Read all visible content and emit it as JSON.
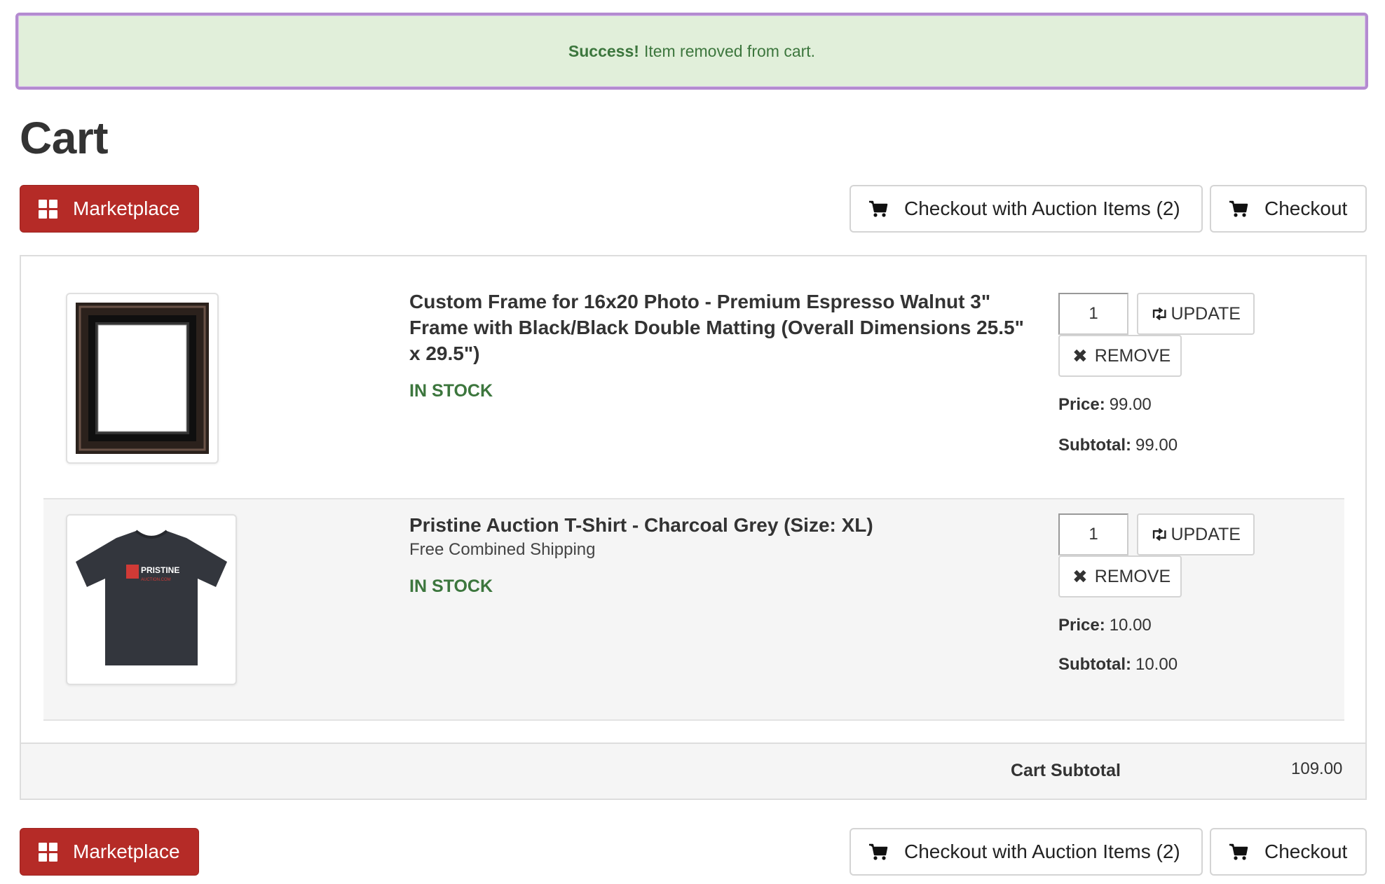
{
  "alert": {
    "strong": "Success!",
    "message": "Item removed from cart."
  },
  "page": {
    "title": "Cart"
  },
  "toolbar": {
    "marketplace_label": "Marketplace",
    "checkout_auction_label": "Checkout with Auction Items (2)",
    "checkout_label": "Checkout"
  },
  "items": [
    {
      "title": "Custom Frame for 16x20 Photo - Premium Espresso Walnut 3\" Frame with Black/Black Double Matting (Overall Dimensions 25.5\" x 29.5\")",
      "subtitle": "",
      "stock": "IN STOCK",
      "qty": "1",
      "update_label": "UPDATE",
      "remove_label": "REMOVE",
      "price_label": "Price:",
      "price": "99.00",
      "subtotal_label": "Subtotal:",
      "subtotal": "99.00"
    },
    {
      "title": "Pristine Auction T-Shirt - Charcoal Grey (Size: XL)",
      "subtitle": "Free Combined Shipping",
      "stock": "IN STOCK",
      "qty": "1",
      "update_label": "UPDATE",
      "remove_label": "REMOVE",
      "price_label": "Price:",
      "price": "10.00",
      "subtotal_label": "Subtotal:",
      "subtotal": "10.00",
      "shirt_brand": "PRISTINE",
      "shirt_brand_sub": "AUCTION.COM"
    }
  ],
  "cart": {
    "subtotal_label": "Cart Subtotal",
    "subtotal": "109.00"
  },
  "colors": {
    "primary_red": "#b52b27",
    "success_bg": "#e1efda",
    "success_text": "#3c763d",
    "alert_border": "#b48bd0"
  },
  "icons": {
    "marketplace": "grid-icon",
    "checkout": "cart-icon",
    "update": "retweet-icon",
    "remove": "close-icon"
  }
}
